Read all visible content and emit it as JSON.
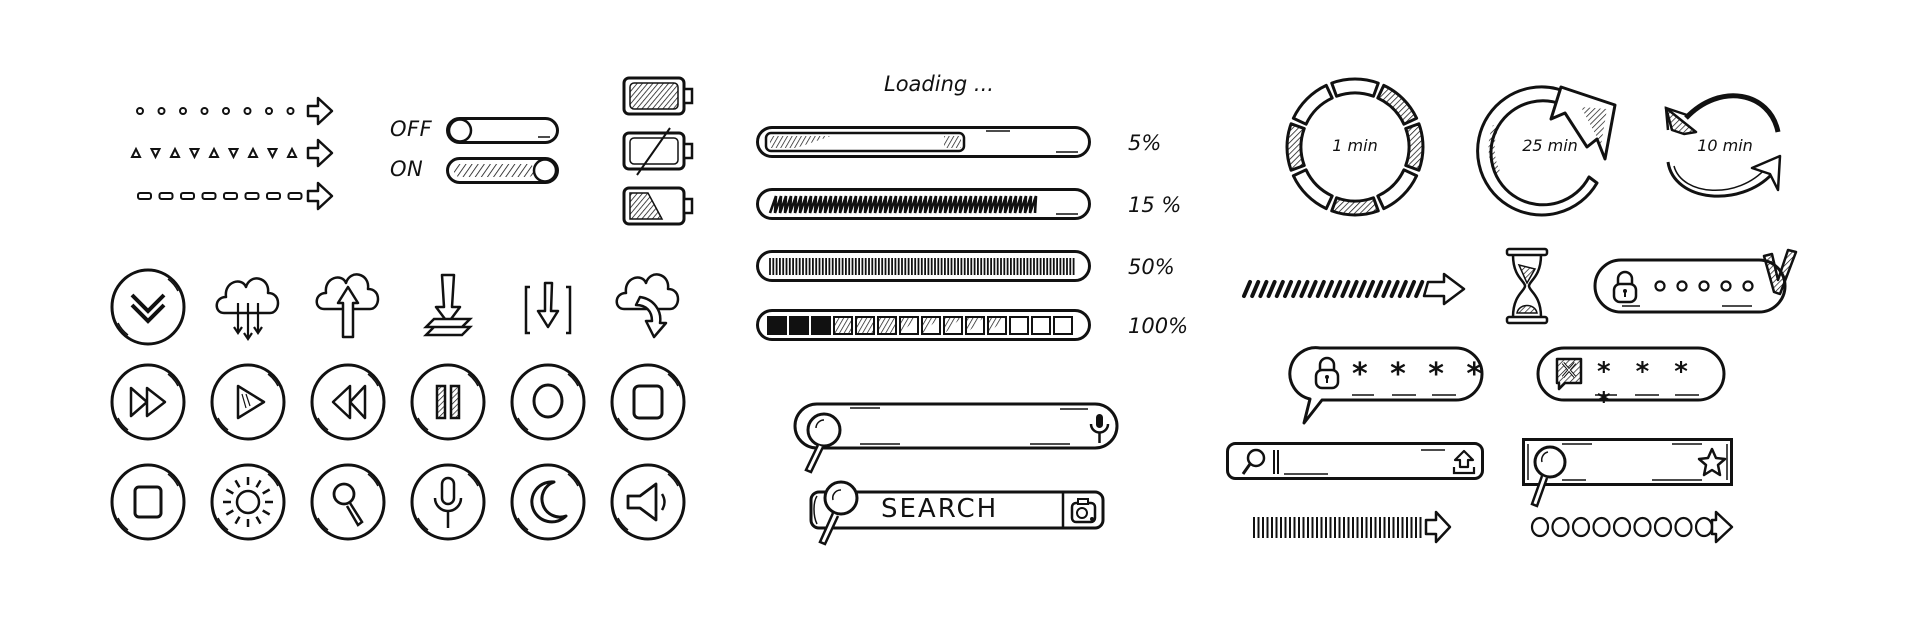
{
  "arrows": {
    "dotted": {
      "icon": "dotted-arrow-icon",
      "markers": 8
    },
    "triangles": {
      "icon": "triangle-arrow-icon",
      "markers": 9
    },
    "dashed": {
      "icon": "dashed-arrow-icon",
      "markers": 8
    }
  },
  "toggles": [
    {
      "label": "OFF",
      "state": "off"
    },
    {
      "label": "ON",
      "state": "on"
    }
  ],
  "batteries": [
    {
      "icon": "battery-full-icon",
      "level": 1.0
    },
    {
      "icon": "battery-empty-icon",
      "level": 0.0,
      "strikethrough": true
    },
    {
      "icon": "battery-low-icon",
      "level": 0.45
    }
  ],
  "loading": {
    "title": "Loading ...",
    "bars": [
      {
        "percent_label": "5%",
        "style": "hatched-inner",
        "fill": 0.6
      },
      {
        "percent_label": "15 %",
        "style": "zigzag",
        "fill": 0.9
      },
      {
        "percent_label": "50%",
        "style": "vertical-lines",
        "fill": 1.0
      },
      {
        "percent_label": "100%",
        "style": "segments",
        "segments_total": 14,
        "segments_filled_solid": 3,
        "segments_hatched": 3,
        "segments_partial": 5
      }
    ]
  },
  "icon_grid": {
    "rows": [
      [
        "double-chevron-down-icon",
        "cloud-download-icon",
        "cloud-upload-icon",
        "download-to-tray-icon",
        "download-bracket-icon",
        "cloud-arrow-down-icon"
      ],
      [
        "fast-forward-icon",
        "play-icon",
        "rewind-icon",
        "pause-icon",
        "record-icon",
        "stop-icon"
      ],
      [
        "stop-square-icon",
        "brightness-icon",
        "search-icon",
        "microphone-icon",
        "moon-icon",
        "speaker-icon"
      ]
    ]
  },
  "search_bars": {
    "mic_bar": {
      "placeholder": "",
      "icon_left": "magnifier-icon",
      "icon_right": "microphone-icon"
    },
    "camera_bar": {
      "value": "SEARCH",
      "icon_left": "magnifier-icon",
      "icon_right": "camera-icon"
    },
    "upload_bar": {
      "placeholder": "",
      "icon_left": "magnifier-icon",
      "icon_right": "upload-icon"
    },
    "star_bar": {
      "placeholder": "",
      "icon_left": "magnifier-icon",
      "icon_right": "star-icon"
    }
  },
  "timers": [
    {
      "label": "1 min",
      "icon": "segmented-ring-icon"
    },
    {
      "label": "25 min",
      "icon": "refresh-arrow-icon"
    },
    {
      "label": "10 min",
      "icon": "sync-arrows-icon"
    }
  ],
  "progress_arrows": {
    "slashes": {
      "icon": "slash-arrow-icon"
    },
    "bars": {
      "icon": "bar-arrow-icon"
    },
    "circles": {
      "icon": "circle-arrow-icon",
      "markers": 9
    }
  },
  "hourglass": {
    "icon": "hourglass-icon"
  },
  "passwords": [
    {
      "icon": "lock-icon",
      "masked": "○ ○ ○ ○ ○",
      "status": "check-icon"
    },
    {
      "icon": "lock-icon",
      "masked": "* * * *",
      "style": "speech-bubble"
    },
    {
      "icon": "error-x-icon",
      "masked": "* * * *"
    }
  ]
}
